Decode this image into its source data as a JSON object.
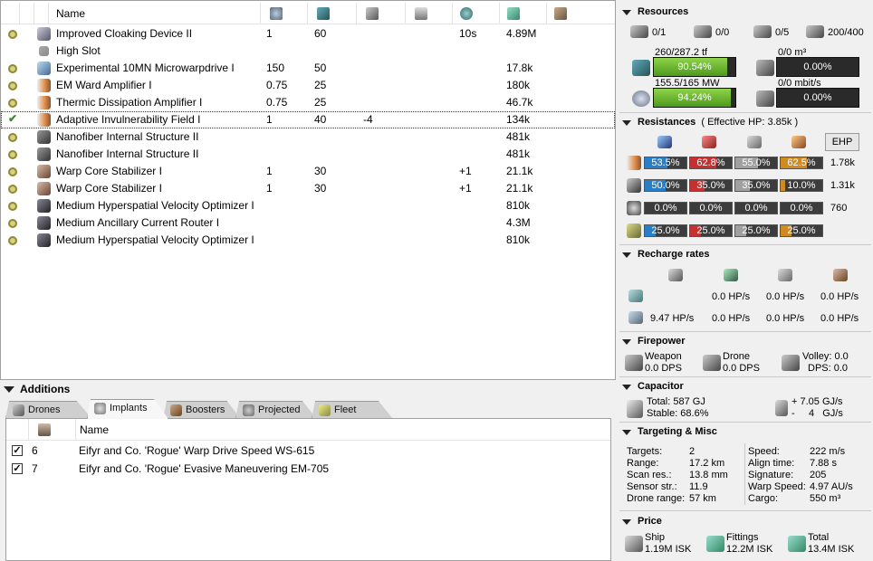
{
  "modules": {
    "columns": {
      "name": "Name"
    },
    "header_icons": [
      "cpu-icon",
      "powergrid-icon",
      "capacitor-icon",
      "turret-icon",
      "optimal-icon",
      "price-icon",
      "charge-icon"
    ],
    "rows": [
      {
        "state": "active",
        "icon": "cloaking-icon",
        "name": "Improved Cloaking Device II",
        "cpu": "1",
        "pg": "60",
        "cap": "",
        "range": "10s",
        "price": "4.89M"
      },
      {
        "state": "none",
        "icon": "high-slot-icon",
        "name": "High Slot",
        "cpu": "",
        "pg": "",
        "cap": "",
        "range": "",
        "price": ""
      },
      {
        "state": "active",
        "icon": "microwarpdrive-icon",
        "name": "Experimental 10MN Microwarpdrive I",
        "cpu": "150",
        "pg": "50",
        "cap": "",
        "range": "",
        "price": "17.8k"
      },
      {
        "state": "active",
        "icon": "shield-amplifier-icon",
        "name": "EM Ward Amplifier I",
        "cpu": "0.75",
        "pg": "25",
        "cap": "",
        "range": "",
        "price": "180k"
      },
      {
        "state": "active",
        "icon": "shield-amplifier-icon",
        "name": "Thermic Dissipation Amplifier I",
        "cpu": "0.75",
        "pg": "25",
        "cap": "",
        "range": "",
        "price": "46.7k"
      },
      {
        "state": "checked",
        "icon": "invulnerability-field-icon",
        "name": "Adaptive Invulnerability Field I",
        "cpu": "1",
        "pg": "40",
        "cap": "-4",
        "range": "",
        "price": "134k"
      },
      {
        "state": "active",
        "icon": "nanofiber-icon",
        "name": "Nanofiber Internal Structure II",
        "cpu": "",
        "pg": "",
        "cap": "",
        "range": "",
        "price": "481k"
      },
      {
        "state": "active",
        "icon": "nanofiber-icon",
        "name": "Nanofiber Internal Structure II",
        "cpu": "",
        "pg": "",
        "cap": "",
        "range": "",
        "price": "481k"
      },
      {
        "state": "active",
        "icon": "warp-core-stabilizer-icon",
        "name": "Warp Core Stabilizer I",
        "cpu": "1",
        "pg": "30",
        "cap": "",
        "range": "+1",
        "price": "21.1k"
      },
      {
        "state": "active",
        "icon": "warp-core-stabilizer-icon",
        "name": "Warp Core Stabilizer I",
        "cpu": "1",
        "pg": "30",
        "cap": "",
        "range": "+1",
        "price": "21.1k"
      },
      {
        "state": "active",
        "icon": "rig-icon",
        "name": "Medium Hyperspatial Velocity Optimizer I",
        "cpu": "",
        "pg": "",
        "cap": "",
        "range": "",
        "price": "810k"
      },
      {
        "state": "active",
        "icon": "rig-icon",
        "name": "Medium Ancillary Current Router I",
        "cpu": "",
        "pg": "",
        "cap": "",
        "range": "",
        "price": "4.3M"
      },
      {
        "state": "active",
        "icon": "rig-icon",
        "name": "Medium Hyperspatial Velocity Optimizer I",
        "cpu": "",
        "pg": "",
        "cap": "",
        "range": "",
        "price": "810k"
      }
    ]
  },
  "additions": {
    "title": "Additions",
    "tabs": [
      {
        "label": "Drones",
        "icon": "drone-icon"
      },
      {
        "label": "Implants",
        "icon": "implant-icon",
        "active": true
      },
      {
        "label": "Boosters",
        "icon": "booster-icon"
      },
      {
        "label": "Projected",
        "icon": "projected-icon"
      },
      {
        "label": "Fleet",
        "icon": "fleet-icon"
      }
    ],
    "implants": {
      "name_header": "Name",
      "rows": [
        {
          "checked": true,
          "slot": "6",
          "name": "Eifyr and Co. 'Rogue' Warp Drive Speed WS-615"
        },
        {
          "checked": true,
          "slot": "7",
          "name": "Eifyr and Co. 'Rogue' Evasive Maneuvering EM-705"
        }
      ]
    }
  },
  "resources": {
    "title": "Resources",
    "hardpoints": [
      {
        "icon": "turret-hardpoint-icon",
        "value": "0/1"
      },
      {
        "icon": "launcher-hardpoint-icon",
        "value": "0/0"
      },
      {
        "icon": "drone-bay-icon",
        "value": "0/5"
      },
      {
        "icon": "calibration-icon",
        "value": "200/400"
      }
    ],
    "cpu": {
      "label": "260/287.2 tf",
      "pct": "90.54%",
      "fraction": 0.9054
    },
    "powergrid": {
      "label": "155.5/165 MW",
      "pct": "94.24%",
      "fraction": 0.9424
    },
    "drone_bay": {
      "label": "0/0 m³",
      "pct": "0.00%",
      "fraction": 0
    },
    "bandwidth": {
      "label": "0/0 mbit/s",
      "pct": "0.00%",
      "fraction": 0
    }
  },
  "resistances": {
    "title": "Resistances",
    "effective_hp": "( Effective HP: 3.85k )",
    "ehp_button": "EHP",
    "rows": [
      {
        "icon": "shield-icon",
        "values": [
          "53.5%",
          "62.8%",
          "55.0%",
          "62.5%"
        ],
        "fractions": [
          0.535,
          0.628,
          0.55,
          0.625
        ],
        "hp": "1.78k"
      },
      {
        "icon": "armor-icon",
        "values": [
          "50.0%",
          "35.0%",
          "35.0%",
          "10.0%"
        ],
        "fractions": [
          0.5,
          0.35,
          0.35,
          0.1
        ],
        "hp": "1.31k"
      },
      {
        "icon": "hull-icon",
        "values": [
          "0.0%",
          "0.0%",
          "0.0%",
          "0.0%"
        ],
        "fractions": [
          0,
          0,
          0,
          0
        ],
        "hp": "760"
      },
      {
        "icon": "damage-pattern-icon",
        "values": [
          "25.0%",
          "25.0%",
          "25.0%",
          "25.0%"
        ],
        "fractions": [
          0.25,
          0.25,
          0.25,
          0.25
        ],
        "hp": ""
      }
    ],
    "colors": [
      "#2a7ec8",
      "#c83030",
      "#a0a0a0",
      "#d08a20"
    ]
  },
  "recharge": {
    "title": "Recharge rates",
    "row1": [
      "0.0 HP/s",
      "0.0 HP/s",
      "0.0 HP/s"
    ],
    "row2": [
      "9.47 HP/s",
      "0.0 HP/s",
      "0.0 HP/s",
      "0.0 HP/s"
    ]
  },
  "firepower": {
    "title": "Firepower",
    "weapon_label": "Weapon",
    "weapon_value": "0.0 DPS",
    "drone_label": "Drone",
    "drone_value": "0.0 DPS",
    "volley_label": "Volley: 0.0",
    "dps_label": "DPS: 0.0"
  },
  "capacitor": {
    "title": "Capacitor",
    "total": "Total:  587 GJ",
    "stable": "Stable: 68.6%",
    "delta_plus": "+ 7.05 GJ/s",
    "delta_minus": "-     4   GJ/s"
  },
  "targeting": {
    "title": "Targeting & Misc",
    "left": [
      {
        "k": "Targets:",
        "v": "2"
      },
      {
        "k": "Range:",
        "v": "17.2 km"
      },
      {
        "k": "Scan res.:",
        "v": "13.8 mm"
      },
      {
        "k": "Sensor str.:",
        "v": "11.9"
      },
      {
        "k": "Drone range:",
        "v": "57 km"
      }
    ],
    "right": [
      {
        "k": "Speed:",
        "v": "222 m/s"
      },
      {
        "k": "Align time:",
        "v": "7.88 s"
      },
      {
        "k": "Signature:",
        "v": "205"
      },
      {
        "k": "Warp Speed:",
        "v": "4.97 AU/s"
      },
      {
        "k": "Cargo:",
        "v": "550 m³"
      }
    ]
  },
  "price": {
    "title": "Price",
    "ship_label": "Ship",
    "ship_value": "1.19M ISK",
    "fittings_label": "Fittings",
    "fittings_value": "12.2M ISK",
    "total_label": "Total",
    "total_value": "13.4M ISK"
  }
}
